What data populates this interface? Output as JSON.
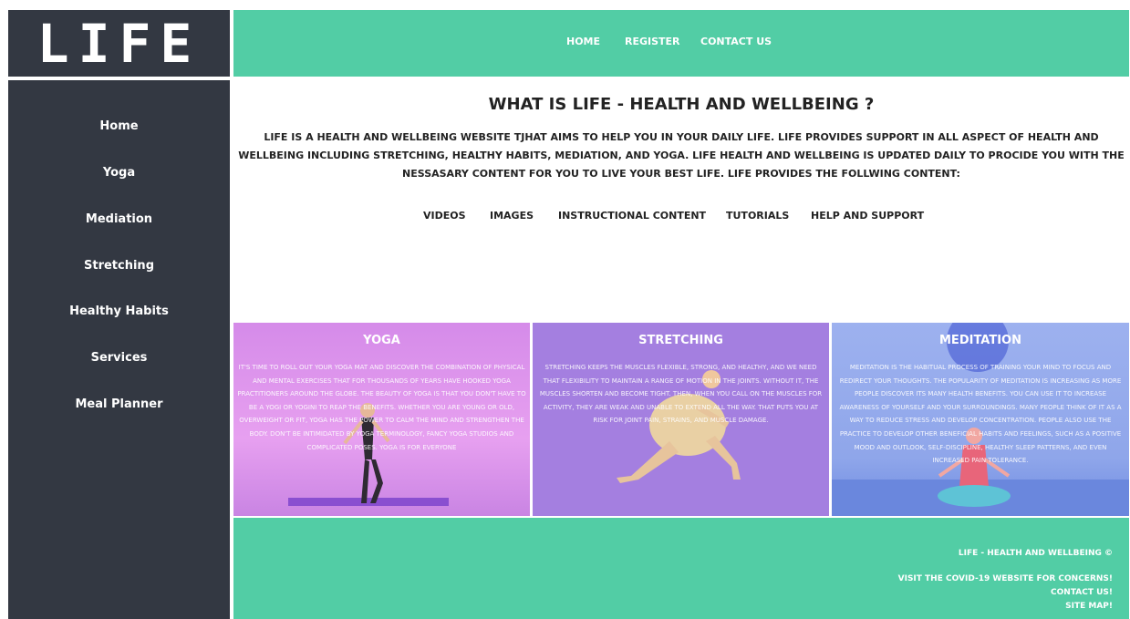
{
  "logo": "LIFE",
  "sidebar": {
    "items": [
      {
        "label": "Home"
      },
      {
        "label": "Yoga"
      },
      {
        "label": "Mediation"
      },
      {
        "label": "Stretching"
      },
      {
        "label": "Healthy Habits"
      },
      {
        "label": "Services"
      },
      {
        "label": "Meal Planner"
      }
    ]
  },
  "topnav": {
    "items": [
      {
        "label": "HOME"
      },
      {
        "label": "REGISTER"
      },
      {
        "label": "CONTACT US"
      }
    ]
  },
  "intro": {
    "title": "WHAT IS LIFE - HEALTH AND WELLBEING ?",
    "text": "LIFE IS A HEALTH AND WELLBEING WEBSITE TJHAT AIMS TO HELP YOU IN YOUR DAILY LIFE. LIFE PROVIDES SUPPORT IN ALL ASPECT OF HEALTH AND WELLBEING INCLUDING STRETCHING, HEALTHY HABITS, MEDIATION, AND YOGA. LIFE HEALTH AND WELLBEING IS UPDATED DAILY TO PROCIDE YOU WITH THE NESSASARY CONTENT FOR YOU TO LIVE YOUR BEST LIFE. LIFE PROVIDES THE FOLLWING CONTENT:"
  },
  "content_types": [
    {
      "label": "VIDEOS"
    },
    {
      "label": "IMAGES"
    },
    {
      "label": "INSTRUCTIONAL CONTENT"
    },
    {
      "label": "TUTORIALS"
    },
    {
      "label": "HELP AND SUPPORT"
    }
  ],
  "panels": [
    {
      "title": "YOGA",
      "text": "IT'S TIME TO ROLL OUT YOUR YOGA MAT AND DISCOVER THE COMBINATION OF PHYSICAL AND MENTAL EXERCISES THAT FOR THOUSANDS OF YEARS HAVE HOOKED YOGA PRACTITIONERS AROUND THE GLOBE. THE BEAUTY OF YOGA IS THAT YOU DON'T HAVE TO BE A YOGI OR YOGINI TO REAP THE BENEFITS. WHETHER YOU ARE YOUNG OR OLD, OVERWEIGHT OR FIT, YOGA HAS THE POWER TO CALM THE MIND AND STRENGTHEN THE BODY. DON'T BE INTIMIDATED BY YOGA TERMINOLOGY, FANCY YOGA STUDIOS AND COMPLICATED POSES. YOGA IS FOR EVERYONE",
      "bg": "#d88ce8"
    },
    {
      "title": "STRETCHING",
      "text": "STRETCHING KEEPS THE MUSCLES FLEXIBLE, STRONG, AND HEALTHY, AND WE NEED THAT FLEXIBILITY TO MAINTAIN A RANGE OF MOTION IN THE JOINTS. WITHOUT IT, THE MUSCLES SHORTEN AND BECOME TIGHT. THEN, WHEN YOU CALL ON THE MUSCLES FOR ACTIVITY, THEY ARE WEAK AND UNABLE TO EXTEND ALL THE WAY. THAT PUTS YOU AT RISK FOR JOINT PAIN, STRAINS, AND MUSCLE DAMAGE.",
      "bg": "#a77fe0"
    },
    {
      "title": "MEDITATION",
      "text": "MEDITATION IS THE HABITUAL PROCESS OF TRAINING YOUR MIND TO FOCUS AND REDIRECT YOUR THOUGHTS. THE POPULARITY OF MEDITATION IS INCREASING AS MORE PEOPLE DISCOVER ITS MANY HEALTH BENEFITS. YOU CAN USE IT TO INCREASE AWARENESS OF YOURSELF AND YOUR SURROUNDINGS. MANY PEOPLE THINK OF IT AS A WAY TO REDUCE STRESS AND DEVELOP CONCENTRATION. PEOPLE ALSO USE THE PRACTICE TO DEVELOP OTHER BENEFICIAL HABITS AND FEELINGS, SUCH AS A POSITIVE MOOD AND OUTLOOK, SELF-DISCIPLINE, HEALTHY SLEEP PATTERNS, AND EVEN INCREASED PAIN TOLERANCE.",
      "bg": "#95a9ea"
    }
  ],
  "footer": {
    "copyright": "LIFE - HEALTH AND WELLBEING ©",
    "covid": "VISIT THE COVID-19 WEBSITE FOR CONCERNS!",
    "contact": "CONTACT US!",
    "sitemap": "SITE MAP!"
  },
  "colors": {
    "dark": "#333842",
    "accent": "#52cda5",
    "text": "#222222"
  }
}
